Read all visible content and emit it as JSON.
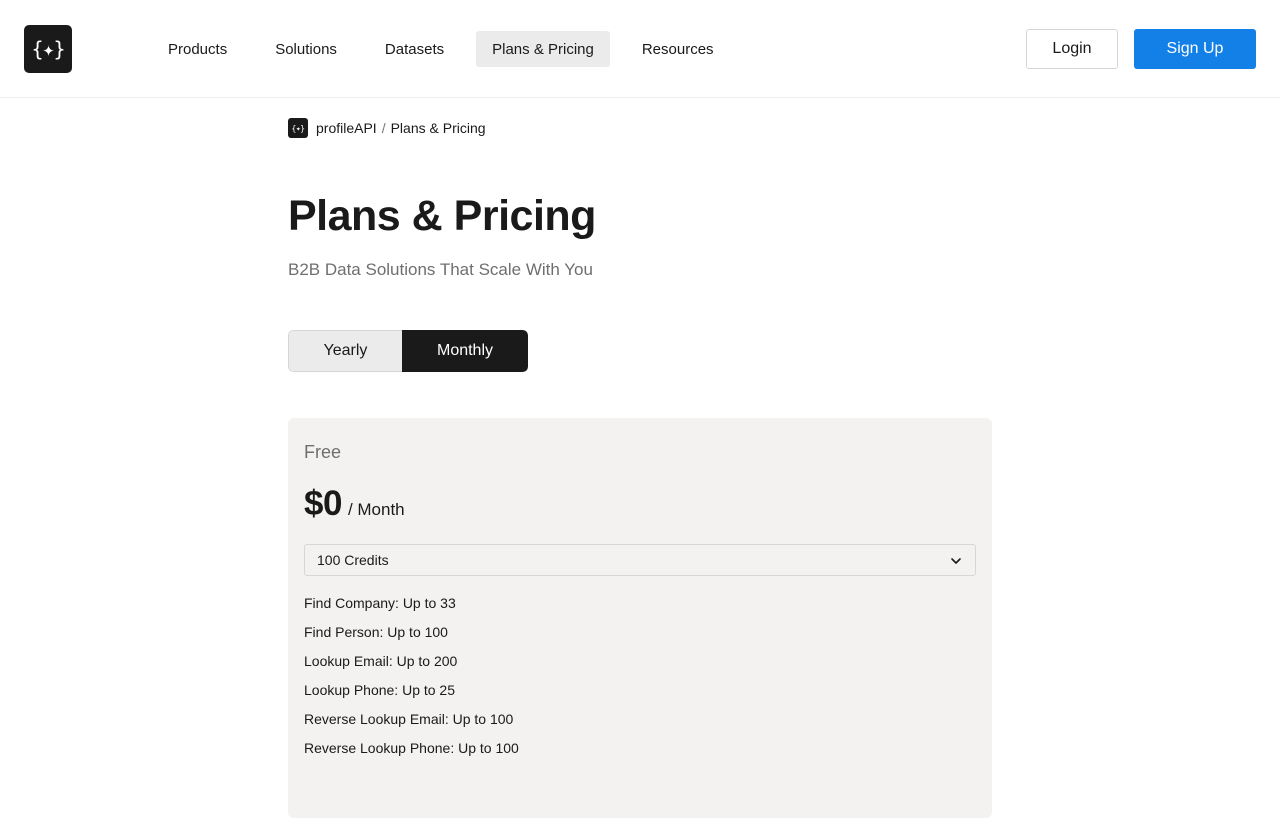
{
  "header": {
    "logo_glyph": "{✦}",
    "nav": [
      {
        "label": "Products"
      },
      {
        "label": "Solutions"
      },
      {
        "label": "Datasets"
      },
      {
        "label": "Plans & Pricing",
        "active": true
      },
      {
        "label": "Resources"
      }
    ],
    "login_label": "Login",
    "signup_label": "Sign Up",
    "accent_color": "#1280e6"
  },
  "breadcrumb": {
    "logo_glyph": "{✦}",
    "home": "profileAPI",
    "separator": "/",
    "current": "Plans & Pricing"
  },
  "page": {
    "title": "Plans & Pricing",
    "subtitle": "B2B Data Solutions That Scale With You"
  },
  "billing_toggle": {
    "options": [
      "Yearly",
      "Monthly"
    ],
    "selected": "Monthly"
  },
  "plan": {
    "name": "Free",
    "price": "$0",
    "period": "/ Month",
    "credits_selected": "100 Credits",
    "features": [
      "Find Company: Up to 33",
      "Find Person: Up to 100",
      "Lookup Email: Up to 200",
      "Lookup Phone: Up to 25",
      "Reverse Lookup Email: Up to 100",
      "Reverse Lookup Phone: Up to 100"
    ]
  }
}
